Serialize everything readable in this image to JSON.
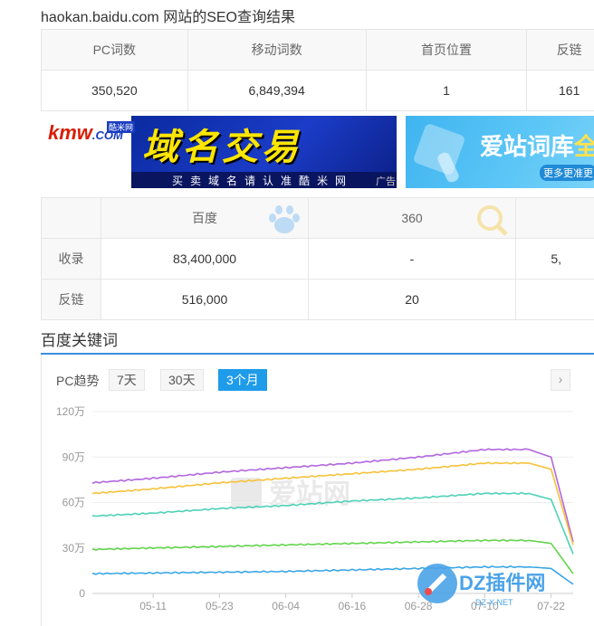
{
  "page": {
    "title": "haokan.baidu.com 网站的SEO查询结果"
  },
  "seo_table": {
    "headers": [
      "PC词数",
      "移动词数",
      "首页位置",
      "反链"
    ],
    "values": [
      "350,520",
      "6,849,394",
      "1",
      "161"
    ]
  },
  "banners": {
    "kmw": {
      "logo_text": "kmw",
      "logo_com": ".COM",
      "logo_badge": "酷米网",
      "headline": "域名交易",
      "slogan": "买卖域名请认准酷米网",
      "ad_label": "广告",
      "colors": {
        "bg": "#1b3cc8",
        "headline": "#ffe600"
      }
    },
    "aizhan": {
      "title": "爱站词库",
      "title_highlight": "全",
      "subtitle": "更多更准更",
      "colors": {
        "bg": "#4fbef4"
      }
    }
  },
  "index_table": {
    "headers": [
      "",
      "百度",
      "360",
      ""
    ],
    "rows": [
      {
        "label": "收录",
        "values": [
          "83,400,000",
          "-",
          "5,"
        ]
      },
      {
        "label": "反链",
        "values": [
          "516,000",
          "20",
          ""
        ]
      }
    ],
    "icons": [
      "paw-icon",
      "magnifier-icon"
    ]
  },
  "keywords_section": {
    "title": "百度关键词",
    "trend_label": "PC趋势",
    "tabs": [
      {
        "label": "7天",
        "active": false
      },
      {
        "label": "30天",
        "active": false
      },
      {
        "label": "3个月",
        "active": true
      }
    ],
    "next_icon": "chevron-right-icon",
    "next_label": "›"
  },
  "watermarks": {
    "chart": "爱站网",
    "corner": "DZ插件网",
    "corner_sub": "DZ-X.NET"
  },
  "chart_data": {
    "type": "line",
    "x_ticks": [
      "05-11",
      "05-23",
      "06-04",
      "06-16",
      "06-28",
      "07-10",
      "07-22"
    ],
    "y_ticks": [
      "0",
      "30万",
      "60万",
      "90万",
      "120万"
    ],
    "ylim": [
      0,
      1200000
    ],
    "grid": true,
    "x": [
      "04-30",
      "05-11",
      "05-23",
      "06-04",
      "06-16",
      "06-28",
      "07-10",
      "07-18",
      "07-22",
      "07-26"
    ],
    "series": [
      {
        "color": "#b266e0",
        "values": [
          730000,
          760000,
          800000,
          830000,
          860000,
          900000,
          950000,
          950000,
          900000,
          340000
        ]
      },
      {
        "color": "#f7c23a",
        "values": [
          660000,
          690000,
          730000,
          760000,
          790000,
          820000,
          860000,
          860000,
          820000,
          320000
        ]
      },
      {
        "color": "#4fd1b6",
        "values": [
          510000,
          530000,
          560000,
          580000,
          610000,
          630000,
          660000,
          660000,
          620000,
          260000
        ]
      },
      {
        "color": "#62d44c",
        "values": [
          290000,
          300000,
          310000,
          320000,
          330000,
          340000,
          350000,
          350000,
          330000,
          130000
        ]
      },
      {
        "color": "#3aa6e6",
        "values": [
          130000,
          135000,
          140000,
          145000,
          155000,
          165000,
          175000,
          175000,
          165000,
          60000
        ]
      }
    ]
  }
}
